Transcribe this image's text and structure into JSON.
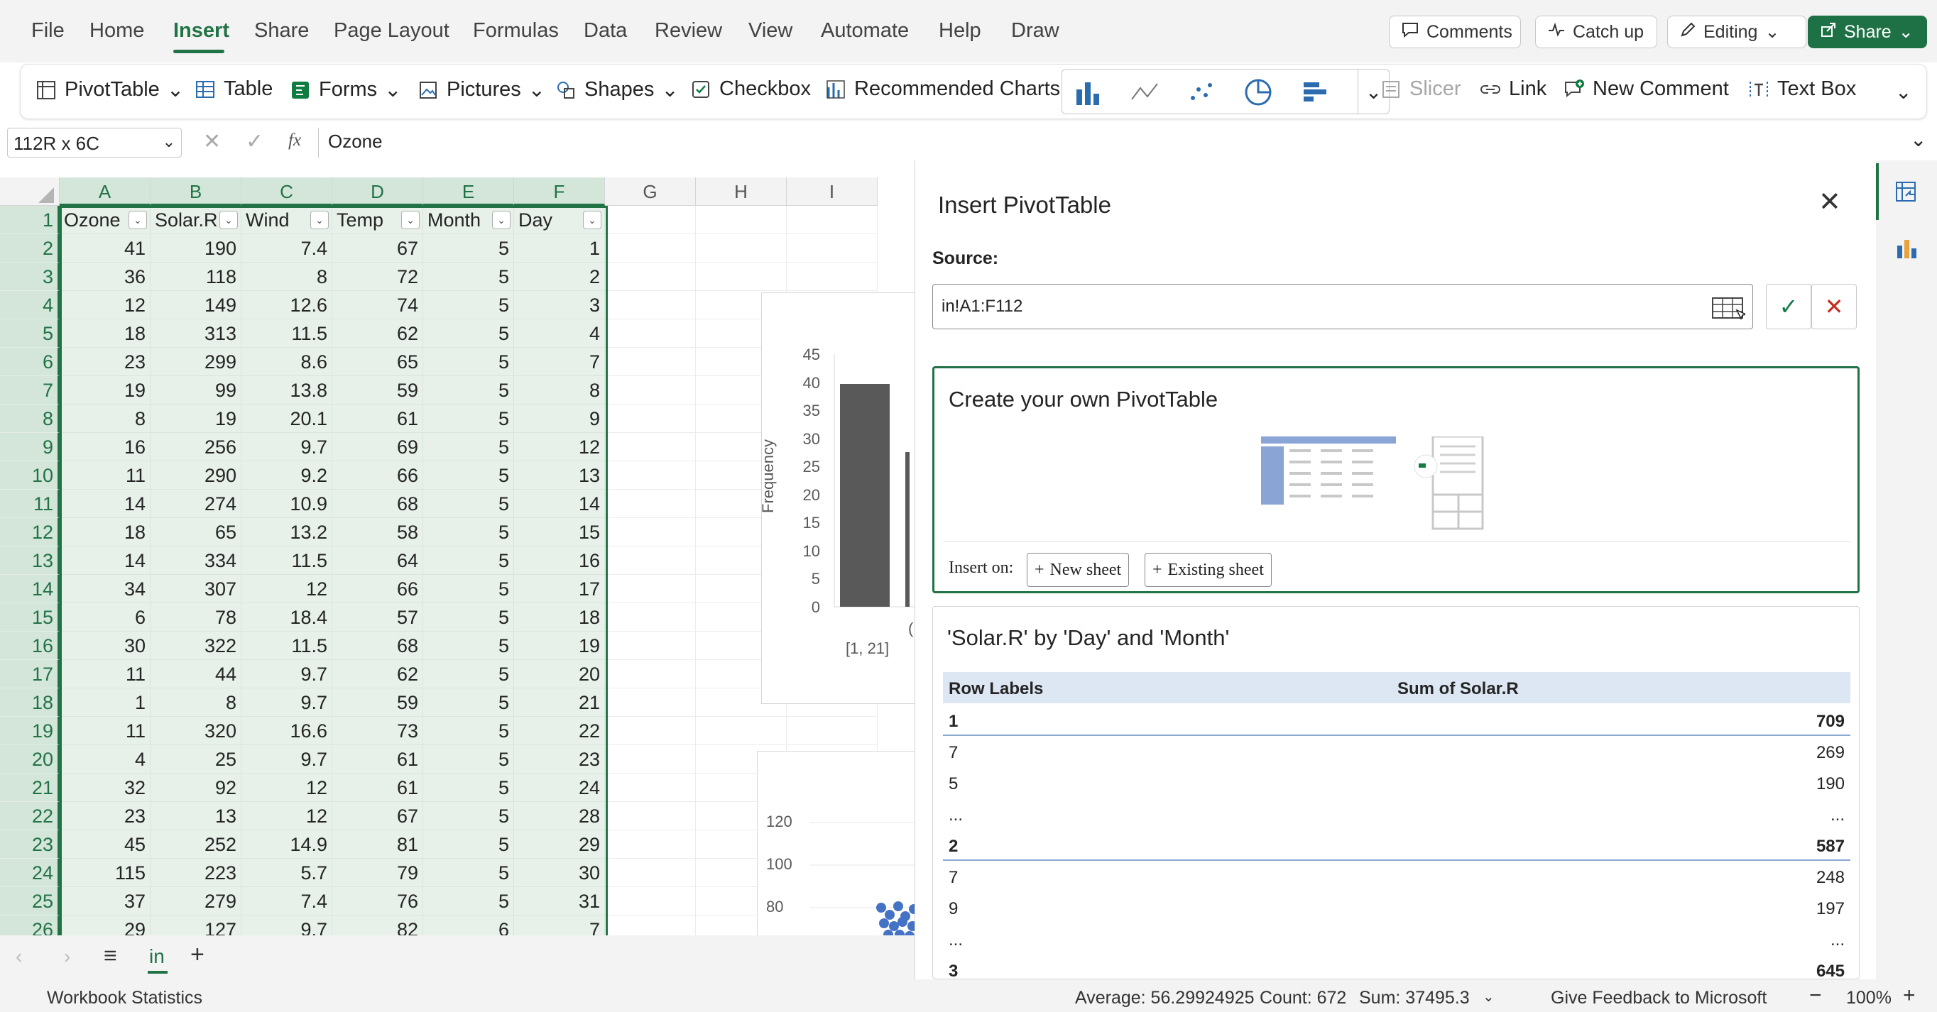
{
  "menu": {
    "items": [
      "File",
      "Home",
      "Insert",
      "Share",
      "Page Layout",
      "Formulas",
      "Data",
      "Review",
      "View",
      "Automate",
      "Help",
      "Draw"
    ],
    "active": "Insert",
    "comments": "Comments",
    "catchup": "Catch up",
    "editing": "Editing",
    "share": "Share"
  },
  "ribbon": {
    "pivottable": "PivotTable",
    "table": "Table",
    "forms": "Forms",
    "pictures": "Pictures",
    "shapes": "Shapes",
    "checkbox": "Checkbox",
    "recommended_charts": "Recommended Charts",
    "slicer": "Slicer",
    "link": "Link",
    "new_comment": "New Comment",
    "text_box": "Text Box"
  },
  "formula": {
    "namebox": "112R x 6C",
    "fx": "fx",
    "value": "Ozone"
  },
  "grid": {
    "columns": [
      "A",
      "B",
      "C",
      "D",
      "E",
      "F",
      "G",
      "H",
      "I"
    ],
    "headers": [
      "Ozone",
      "Solar.R",
      "Wind",
      "Temp",
      "Month",
      "Day"
    ],
    "row_numbers": [
      "1",
      "2",
      "3",
      "4",
      "5",
      "6",
      "7",
      "8",
      "9",
      "10",
      "11",
      "12",
      "13",
      "14",
      "15",
      "16",
      "17",
      "18",
      "19",
      "20",
      "21",
      "22",
      "23",
      "24",
      "25",
      "26"
    ],
    "rows": [
      [
        "41",
        "190",
        "7.4",
        "67",
        "5",
        "1"
      ],
      [
        "36",
        "118",
        "8",
        "72",
        "5",
        "2"
      ],
      [
        "12",
        "149",
        "12.6",
        "74",
        "5",
        "3"
      ],
      [
        "18",
        "313",
        "11.5",
        "62",
        "5",
        "4"
      ],
      [
        "23",
        "299",
        "8.6",
        "65",
        "5",
        "7"
      ],
      [
        "19",
        "99",
        "13.8",
        "59",
        "5",
        "8"
      ],
      [
        "8",
        "19",
        "20.1",
        "61",
        "5",
        "9"
      ],
      [
        "16",
        "256",
        "9.7",
        "69",
        "5",
        "12"
      ],
      [
        "11",
        "290",
        "9.2",
        "66",
        "5",
        "13"
      ],
      [
        "14",
        "274",
        "10.9",
        "68",
        "5",
        "14"
      ],
      [
        "18",
        "65",
        "13.2",
        "58",
        "5",
        "15"
      ],
      [
        "14",
        "334",
        "11.5",
        "64",
        "5",
        "16"
      ],
      [
        "34",
        "307",
        "12",
        "66",
        "5",
        "17"
      ],
      [
        "6",
        "78",
        "18.4",
        "57",
        "5",
        "18"
      ],
      [
        "30",
        "322",
        "11.5",
        "68",
        "5",
        "19"
      ],
      [
        "11",
        "44",
        "9.7",
        "62",
        "5",
        "20"
      ],
      [
        "1",
        "8",
        "9.7",
        "59",
        "5",
        "21"
      ],
      [
        "11",
        "320",
        "16.6",
        "73",
        "5",
        "22"
      ],
      [
        "4",
        "25",
        "9.7",
        "61",
        "5",
        "23"
      ],
      [
        "32",
        "92",
        "12",
        "61",
        "5",
        "24"
      ],
      [
        "23",
        "13",
        "12",
        "67",
        "5",
        "28"
      ],
      [
        "45",
        "252",
        "14.9",
        "81",
        "5",
        "29"
      ],
      [
        "115",
        "223",
        "5.7",
        "79",
        "5",
        "30"
      ],
      [
        "37",
        "279",
        "7.4",
        "76",
        "5",
        "31"
      ],
      [
        "29",
        "127",
        "9.7",
        "82",
        "6",
        "7"
      ]
    ]
  },
  "charts": {
    "hist": {
      "ylabel": "Frequency",
      "yticks": [
        "45",
        "40",
        "35",
        "30",
        "25",
        "20",
        "15",
        "10",
        "5",
        "0"
      ],
      "xlabel_first": "[1, 21]",
      "xlabel_partial": "("
    },
    "scatter": {
      "yticks": [
        "120",
        "100",
        "80"
      ]
    }
  },
  "sheet": {
    "tab": "in"
  },
  "status": {
    "workbook_stats": "Workbook Statistics",
    "average": "Average: 56.29924925",
    "count": "Count: 672",
    "sum": "Sum: 37495.3",
    "feedback": "Give Feedback to Microsoft",
    "zoom": "100%"
  },
  "panel": {
    "title": "Insert PivotTable",
    "source_label": "Source:",
    "source_value": "in!A1:F112",
    "create_own": "Create your own PivotTable",
    "insert_on": "Insert on:",
    "new_sheet": "New sheet",
    "existing_sheet": "Existing sheet",
    "suggestion_title": "'Solar.R' by 'Day' and 'Month'",
    "col_row_labels": "Row Labels",
    "col_sum": "Sum of Solar.R",
    "rows": [
      {
        "label": "1",
        "value": "709",
        "bold": true
      },
      {
        "label": "7",
        "value": "269",
        "bold": false
      },
      {
        "label": "5",
        "value": "190",
        "bold": false
      },
      {
        "label": "...",
        "value": "...",
        "bold": false
      },
      {
        "label": "2",
        "value": "587",
        "bold": true
      },
      {
        "label": "7",
        "value": "248",
        "bold": false
      },
      {
        "label": "9",
        "value": "197",
        "bold": false
      },
      {
        "label": "...",
        "value": "...",
        "bold": false
      },
      {
        "label": "3",
        "value": "645",
        "bold": true
      }
    ]
  },
  "colors": {
    "accent": "#217346",
    "bar": "#595959",
    "scatter": "#4472c4"
  }
}
